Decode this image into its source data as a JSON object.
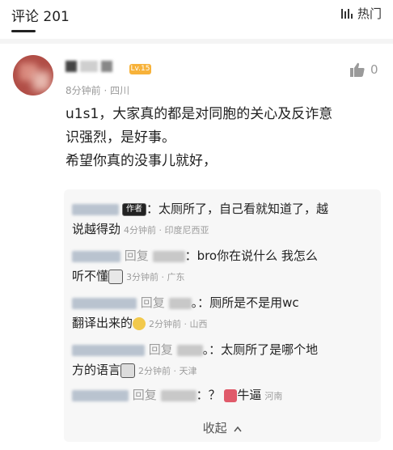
{
  "header": {
    "title": "评论 201",
    "sort_label": "热门"
  },
  "comment": {
    "level": "Lv.15",
    "meta": "8分钟前 · 四川",
    "likes": "0",
    "lines": [
      "u1s1，大家真的都是对同胞的关心及反诈意",
      "识强烈，是好事。",
      "希望你真的没事儿就好，"
    ]
  },
  "replies": [
    {
      "tag": "作者",
      "text": "：太厕所了，自己看就知道了，越",
      "text2": "说越得劲",
      "meta": "4分钟前 · 印度尼西亚"
    },
    {
      "reply_word": "回复",
      "text": "：bro你在说什么 我怎么",
      "text2": "听不懂",
      "meta": "3分钟前 · 广东"
    },
    {
      "reply_word": "回复",
      "text": "。：厕所是不是用wc",
      "text2": "翻译出来的",
      "meta": "2分钟前 · 山西"
    },
    {
      "reply_word": "回复",
      "text": "。：太厕所了是哪个地",
      "text2": "方的语言",
      "meta": "2分钟前 · 天津"
    },
    {
      "reply_word": "回复",
      "text": "：？",
      "text2": "牛逼",
      "meta": "河南"
    }
  ],
  "collapse_label": "收起"
}
